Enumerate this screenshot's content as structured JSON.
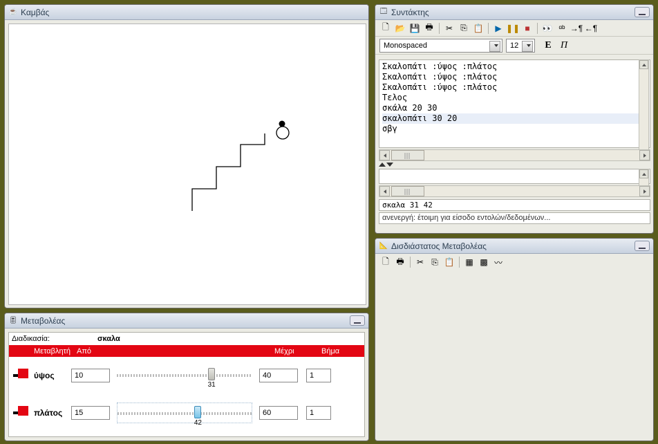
{
  "canvas": {
    "title": "Καμβάς"
  },
  "editor": {
    "title": "Συντάκτης",
    "font_name": "Monospaced",
    "font_size": "12",
    "bold_label": "E",
    "italic_label": "Π",
    "lines": [
      "Σκαλοπάτι :ύψος :πλάτος",
      "Σκαλοπάτι :ύψος :πλάτος",
      "Σκαλοπάτι :ύψος :πλάτος",
      "Τελος",
      "σκάλα 20 30",
      "σκαλοπάτι 30 20",
      "σβγ"
    ],
    "command_line": "σκαλα 31 42",
    "status": "ανενεργή: έτοιμη για είσοδο εντολών/δεδομένων..."
  },
  "meta": {
    "title": "Μεταβολέας",
    "proc_label": "Διαδικασία:",
    "proc_value": "σκαλα",
    "headers": {
      "var": "Μεταβλητή",
      "from": "Από",
      "to": "Μέχρι",
      "step": "Βήμα"
    },
    "rows": [
      {
        "name": "ύψος",
        "from": "10",
        "to": "40",
        "step": "1",
        "value": "31",
        "pct": 70
      },
      {
        "name": "πλάτος",
        "from": "15",
        "to": "60",
        "step": "1",
        "value": "42",
        "pct": 60
      }
    ]
  },
  "d2": {
    "title": "Δισδιάστατος Μεταβολέας"
  },
  "icons": {
    "new": "🗋",
    "open": "📂",
    "save": "💾",
    "print": "🖶",
    "cut": "✂",
    "copy": "⎘",
    "paste": "📋",
    "play": "▶",
    "pause": "❚❚",
    "stop": "■",
    "find": "👀",
    "replace": "ᵅᵇ",
    "indent": "→¶",
    "outdent": "←¶",
    "grid1": "▦",
    "grid2": "▩",
    "curve": "〰"
  }
}
